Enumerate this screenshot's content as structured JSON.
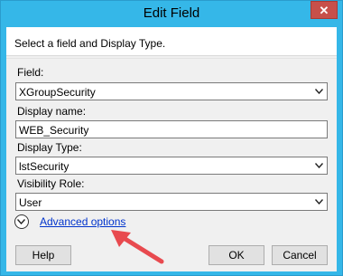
{
  "window": {
    "title": "Edit Field",
    "close_glyph": "✕"
  },
  "header": {
    "instruction": "Select a field and Display Type."
  },
  "form": {
    "field": {
      "label": "Field:",
      "value": "XGroupSecurity"
    },
    "display_name": {
      "label": "Display name:",
      "value": "WEB_Security"
    },
    "display_type": {
      "label": "Display Type:",
      "value": "lstSecurity"
    },
    "visibility_role": {
      "label": "Visibility Role:",
      "value": "User"
    }
  },
  "advanced": {
    "link_label": "Advanced options"
  },
  "buttons": {
    "help": "Help",
    "ok": "OK",
    "cancel": "Cancel"
  },
  "colors": {
    "titlebar": "#35b7e8",
    "close_button": "#c7504a",
    "link": "#0033cc",
    "annotation_arrow": "#e84a4f"
  }
}
